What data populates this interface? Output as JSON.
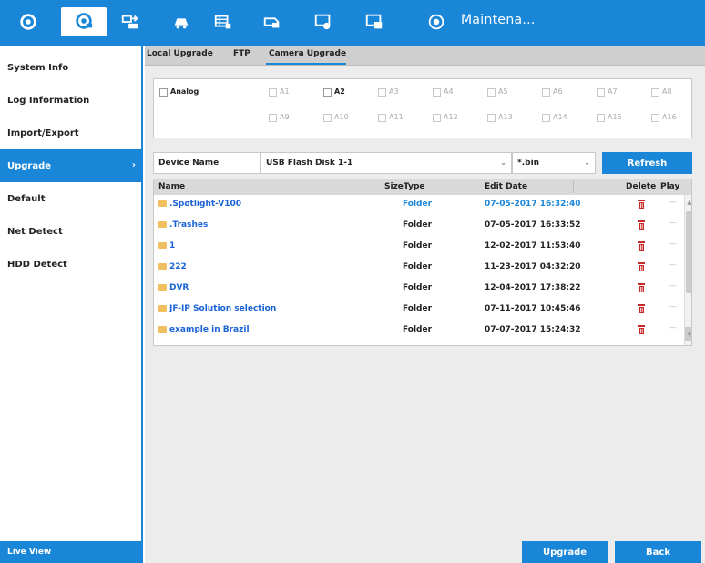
{
  "header": {
    "title": "Maintena...",
    "icons": [
      "settings-icon",
      "camera-icon",
      "network-transfer-icon",
      "record-icon",
      "storage-icon",
      "event-icon",
      "system-icon",
      "device-icon",
      "maintenance-icon"
    ]
  },
  "sidebar": {
    "items": [
      {
        "label": "System Info"
      },
      {
        "label": "Log Information"
      },
      {
        "label": "Import/Export"
      },
      {
        "label": "Upgrade",
        "chevron": "›"
      },
      {
        "label": "Default"
      },
      {
        "label": "Net Detect"
      },
      {
        "label": "HDD Detect"
      }
    ],
    "live_view": "Live View"
  },
  "tabs": [
    {
      "label": "Local Upgrade"
    },
    {
      "label": "FTP"
    },
    {
      "label": "Camera Upgrade"
    }
  ],
  "channels": {
    "analog_label": "Analog",
    "row1": [
      "A1",
      "A2",
      "A3",
      "A4",
      "A5",
      "A6",
      "A7",
      "A8"
    ],
    "row2": [
      "A9",
      "A10",
      "A11",
      "A12",
      "A13",
      "A14",
      "A15",
      "A16"
    ]
  },
  "filter": {
    "device_label": "Device Name",
    "device_value": "USB Flash Disk 1-1",
    "ext_value": "*.bin",
    "refresh": "Refresh"
  },
  "table": {
    "headers": {
      "name": "Name",
      "size": "Size",
      "type": "Type",
      "date": "Edit Date",
      "delete": "Delete",
      "play": "Play"
    },
    "rows": [
      {
        "name": ".Spotlight-V100",
        "type": "Folder",
        "date": "07-05-2017 16:32:40",
        "play": "—"
      },
      {
        "name": ".Trashes",
        "type": "Folder",
        "date": "07-05-2017 16:33:52",
        "play": "—"
      },
      {
        "name": "1",
        "type": "Folder",
        "date": "12-02-2017 11:53:40",
        "play": "—"
      },
      {
        "name": "222",
        "type": "Folder",
        "date": "11-23-2017 04:32:20",
        "play": "—"
      },
      {
        "name": "DVR",
        "type": "Folder",
        "date": "12-04-2017 17:38:22",
        "play": "—"
      },
      {
        "name": "JF-IP Solution selection",
        "type": "Folder",
        "date": "07-11-2017 10:45:46",
        "play": "—"
      },
      {
        "name": "example in Brazil",
        "type": "Folder",
        "date": "07-07-2017 15:24:32",
        "play": "—"
      }
    ]
  },
  "buttons": {
    "upgrade": "Upgrade",
    "back": "Back"
  },
  "colors": {
    "accent": "#1a86d8",
    "delete": "#c62828",
    "link": "#1a63d6"
  }
}
